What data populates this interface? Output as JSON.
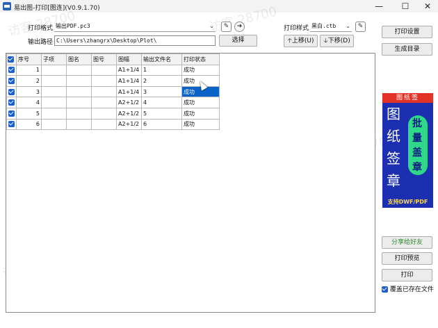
{
  "window": {
    "title": "易出图-打印[图连](V0.9.1.70)",
    "minimize": "—",
    "maximize": "☐",
    "close": "✕"
  },
  "form": {
    "print_format_label": "打印格式",
    "print_format_value": "输出PDF.pc3",
    "output_path_label": "输出路径",
    "output_path_value": "C:\\Users\\zhangrx\\Desktop\\Plot\\",
    "select_button": "选择",
    "print_style_label": "打印样式",
    "print_style_value": "黑白.ctb",
    "move_up_button": "上移(U)",
    "move_down_button": "下移(D)"
  },
  "table": {
    "columns": [
      "序号",
      "子项",
      "图名",
      "图号",
      "图幅",
      "输出文件名",
      "打印状态"
    ],
    "rows": [
      {
        "seq": "1",
        "sub": "",
        "name": "",
        "no": "",
        "size": "A1+1/4",
        "file": "1",
        "status": "成功"
      },
      {
        "seq": "2",
        "sub": "",
        "name": "",
        "no": "",
        "size": "A1+1/4",
        "file": "2",
        "status": "成功"
      },
      {
        "seq": "3",
        "sub": "",
        "name": "",
        "no": "",
        "size": "A1+1/4",
        "file": "3",
        "status": "成功"
      },
      {
        "seq": "4",
        "sub": "",
        "name": "",
        "no": "",
        "size": "A2+1/2",
        "file": "4",
        "status": "成功"
      },
      {
        "seq": "5",
        "sub": "",
        "name": "",
        "no": "",
        "size": "A2+1/2",
        "file": "5",
        "status": "成功"
      },
      {
        "seq": "6",
        "sub": "",
        "name": "",
        "no": "",
        "size": "A2+1/2",
        "file": "6",
        "status": "成功"
      }
    ]
  },
  "side": {
    "print_settings_button": "打印设置",
    "generate_catalog_button": "生成目录",
    "share_button": "分享给好友",
    "print_preview_button": "打印预览",
    "print_button": "打印",
    "overwrite_label": "覆盖已存在文件"
  },
  "ad": {
    "top": "图纸签",
    "big_chars": [
      "图",
      "纸",
      "签",
      "章"
    ],
    "pill_chars": [
      "批",
      "量",
      "盖",
      "章"
    ],
    "bottom": "支持DWF/PDF"
  },
  "watermark": "访客 28700",
  "colors": {
    "accent": "#1a5fd0",
    "selection": "#0a62c9",
    "ad_blue": "#1b2fb0",
    "ad_red": "#e23228",
    "ad_green": "#2fd98a",
    "share_green": "#2f8a2f"
  }
}
